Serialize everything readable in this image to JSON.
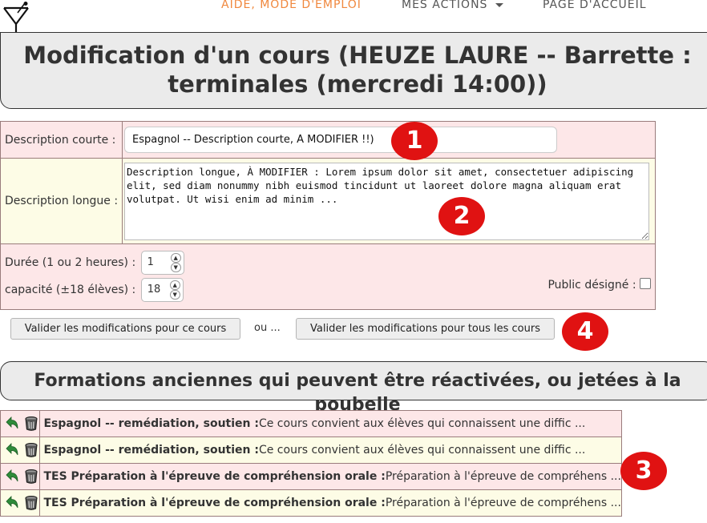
{
  "nav": {
    "help": "Aide, mode d'emploi",
    "actions": "Mes actions",
    "home": "Page d'accueil"
  },
  "page": {
    "title": "Modification d'un cours (HEUZE LAURE -- Barrette : terminales (mercredi 14:00))"
  },
  "form": {
    "short_label": "Description courte :",
    "short_value": "Espagnol -- Description courte, À MODIFIER !!)",
    "long_label": "Description longue :",
    "long_value": "Description longue, À MODIFIER : Lorem ipsum dolor sit amet, consectetuer adipiscing elit, sed diam nonummy nibh euismod tincidunt ut laoreet dolore magna aliquam erat volutpat. Ut wisi enim ad minim ...",
    "duration_label": "Durée (1 ou 2 heures) :",
    "duration_value": "1",
    "capacity_label": "capacité (±18 élèves) :",
    "capacity_value": "18",
    "public_label": "Public désigné :",
    "public_checked": false
  },
  "actions": {
    "validate_one": "Valider les modifications pour ce cours",
    "or": "ou ...",
    "validate_all": "Valider les modifications pour tous les cours"
  },
  "old_section": {
    "title": "Formations anciennes qui peuvent être réactivées, ou jetées à la poubelle",
    "rows": [
      {
        "title": "Espagnol -- remédiation, soutien :",
        "desc": "Ce cours convient aux élèves qui connaissent une diffic ..."
      },
      {
        "title": "Espagnol -- remédiation, soutien :",
        "desc": "Ce cours convient aux élèves qui connaissent une diffic ..."
      },
      {
        "title": "TES Préparation à l'épreuve de compréhension orale :",
        "desc": "Préparation à l'épreuve de compréhens ..."
      },
      {
        "title": "TES Préparation à l'épreuve de compréhension orale :",
        "desc": "Préparation à l'épreuve de compréhens ..."
      }
    ]
  },
  "badges": [
    "1",
    "2",
    "3",
    "4"
  ],
  "colors": {
    "accent_nav": "#f0883e",
    "badge_red": "#e01212",
    "row_pink": "#fde7e8",
    "row_yellow": "#fdfce6",
    "restore_icon_green": "#2e8b3a"
  },
  "icons": {
    "logo": "cocktail-glass-icon",
    "restore": "undo-arrow-icon",
    "trash": "trash-bin-icon",
    "menu_caret": "caret-down-icon"
  }
}
